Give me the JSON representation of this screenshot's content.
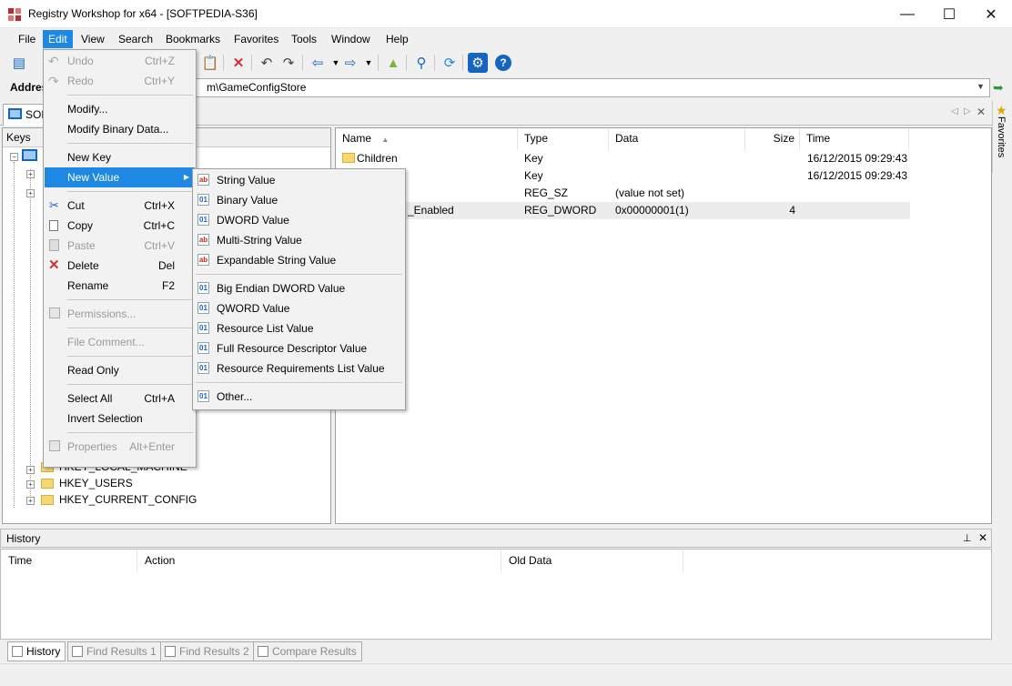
{
  "window": {
    "title": "Registry Workshop for x64 - [SOFTPEDIA-S36]",
    "minimize": "—",
    "maximize": "☐",
    "close": "✕"
  },
  "menubar": [
    "File",
    "Edit",
    "View",
    "Search",
    "Bookmarks",
    "Favorites",
    "Tools",
    "Window",
    "Help"
  ],
  "address": {
    "label": "Address",
    "value": "m\\GameConfigStore"
  },
  "tab": {
    "label": "SOFTPEDIA-S36"
  },
  "favorites_label": "Favorites",
  "keys_panel": {
    "header": "Keys",
    "roots": [
      "HKEY_LOCAL_MACHINE",
      "HKEY_USERS",
      "HKEY_CURRENT_CONFIG"
    ]
  },
  "values_panel": {
    "columns": {
      "name": "Name",
      "type": "Type",
      "data": "Data",
      "size": "Size",
      "time": "Time"
    },
    "rows": [
      {
        "name": "Children",
        "type": "Key",
        "data": "",
        "size": "",
        "time": "16/12/2015 09:29:43"
      },
      {
        "name": "",
        "type": "Key",
        "data": "",
        "size": "",
        "time": "16/12/2015 09:29:43"
      },
      {
        "name": "",
        "type": "REG_SZ",
        "data": "(value not set)",
        "size": "",
        "time": ""
      },
      {
        "name": "_Enabled",
        "type": "REG_DWORD",
        "data": "0x00000001(1)",
        "size": "4",
        "time": ""
      }
    ]
  },
  "edit_menu": [
    {
      "label": "Undo",
      "shortcut": "Ctrl+Z",
      "disabled": true
    },
    {
      "label": "Redo",
      "shortcut": "Ctrl+Y",
      "disabled": true
    },
    {
      "label": "Modify...",
      "shortcut": ""
    },
    {
      "label": "Modify Binary Data...",
      "shortcut": ""
    },
    {
      "label": "New Key",
      "shortcut": ""
    },
    {
      "label": "New Value",
      "shortcut": ""
    },
    {
      "label": "Cut",
      "shortcut": "Ctrl+X"
    },
    {
      "label": "Copy",
      "shortcut": "Ctrl+C"
    },
    {
      "label": "Paste",
      "shortcut": "Ctrl+V",
      "disabled": true
    },
    {
      "label": "Delete",
      "shortcut": "Del"
    },
    {
      "label": "Rename",
      "shortcut": "F2"
    },
    {
      "label": "Permissions...",
      "shortcut": "",
      "disabled": true
    },
    {
      "label": "File Comment...",
      "shortcut": "",
      "disabled": true
    },
    {
      "label": "Read Only",
      "shortcut": ""
    },
    {
      "label": "Select All",
      "shortcut": "Ctrl+A"
    },
    {
      "label": "Invert Selection",
      "shortcut": ""
    },
    {
      "label": "Properties",
      "shortcut": "Alt+Enter",
      "disabled": true
    }
  ],
  "new_value_submenu": [
    {
      "label": "String Value",
      "icon": "ab"
    },
    {
      "label": "Binary Value",
      "icon": "01"
    },
    {
      "label": "DWORD Value",
      "icon": "01"
    },
    {
      "label": "Multi-String Value",
      "icon": "ab"
    },
    {
      "label": "Expandable String Value",
      "icon": "ab"
    },
    {
      "label": "Big Endian DWORD Value",
      "icon": "01"
    },
    {
      "label": "QWORD Value",
      "icon": "01"
    },
    {
      "label": "Resource List Value",
      "icon": "01"
    },
    {
      "label": "Full Resource Descriptor Value",
      "icon": "01"
    },
    {
      "label": "Resource Requirements List Value",
      "icon": "01"
    },
    {
      "label": "Other...",
      "icon": "01"
    }
  ],
  "history": {
    "header": "History",
    "columns": {
      "time": "Time",
      "action": "Action",
      "old_data": "Old Data"
    }
  },
  "bottom_tabs": [
    "History",
    "Find Results 1",
    "Find Results 2",
    "Compare Results"
  ],
  "colors": {
    "accent": "#1e88e5",
    "delete_red": "#d32f2f",
    "toolbar_blue": "#1565c0"
  }
}
